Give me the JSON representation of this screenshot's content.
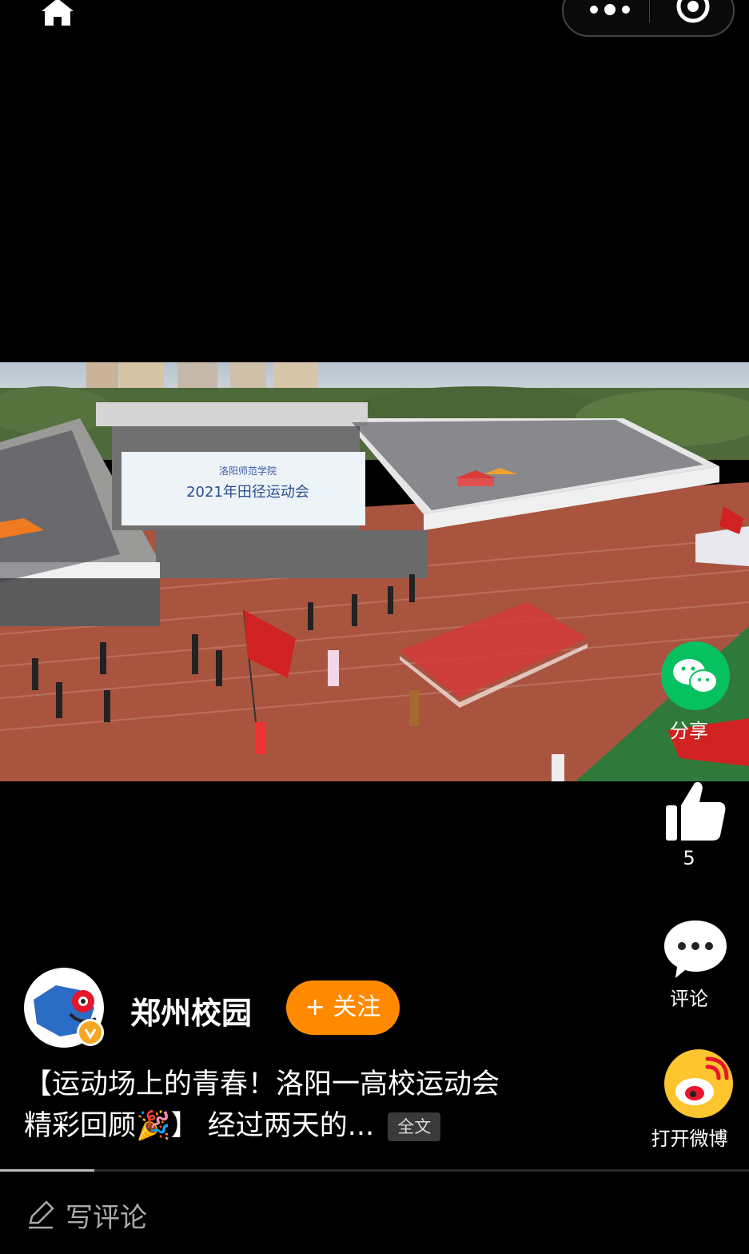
{
  "top_bar": {
    "home_icon": "home-icon",
    "more_icon": "more-dots-icon",
    "close_icon": "close-target-icon"
  },
  "video": {
    "banner_line1": "洛阳师范学院",
    "banner_line2": "2021年田径运动会"
  },
  "side_actions": {
    "share_label": "分享",
    "like_count": "5",
    "comment_label": "评论",
    "weibo_label": "打开微博"
  },
  "author": {
    "name": "郑州校园",
    "follow_label": "+ 关注"
  },
  "post": {
    "text_line1": "【运动场上的青春！洛阳一高校运动会",
    "text_line2": "精彩回顾🎉】 经过两天的...",
    "full_text_label": "全文"
  },
  "comment_bar": {
    "placeholder": "写评论"
  },
  "colors": {
    "background": "#000000",
    "follow": "#ff8a00",
    "wechat": "#07c160",
    "weibo": "#ffc52e"
  }
}
